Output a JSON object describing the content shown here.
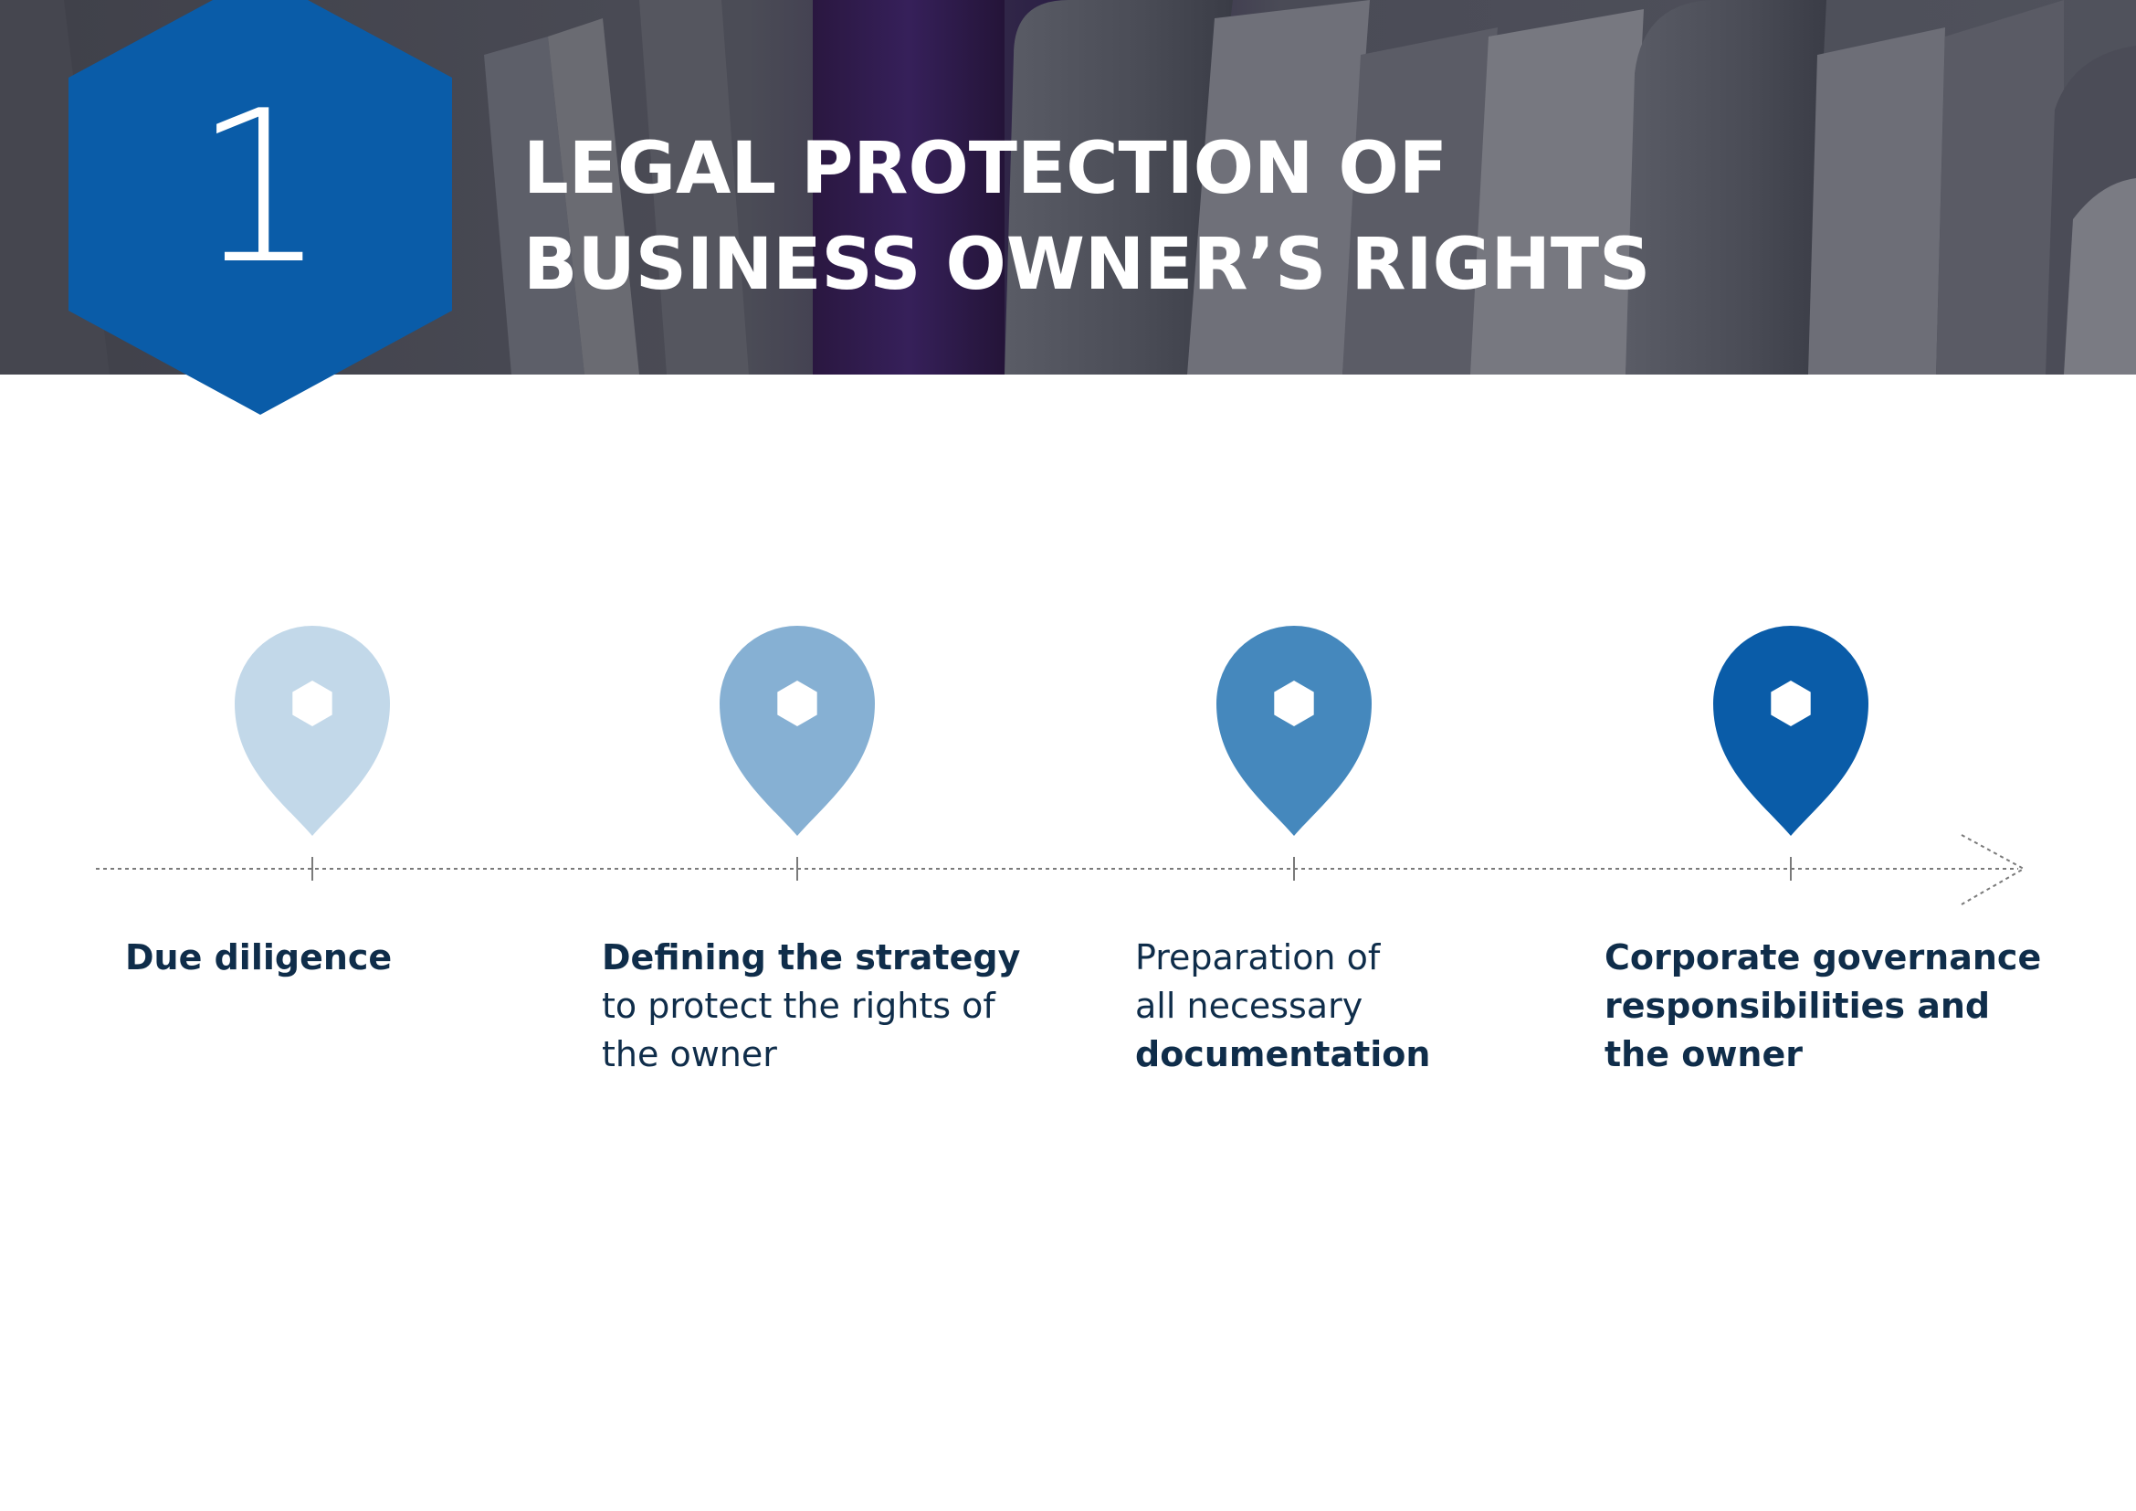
{
  "section": {
    "number": "1",
    "title_line1": "LEGAL PROTECTION OF",
    "title_line2": "BUSINESS OWNER’S RIGHTS"
  },
  "colors": {
    "badge": "#0a5ca8",
    "text_dark": "#0f2d4a",
    "header_bg": "#4a4c57",
    "pins": [
      "#c2d8e9",
      "#86b0d3",
      "#4588bd",
      "#0a5ca8"
    ]
  },
  "steps": [
    {
      "line1_bold": "Due diligence"
    },
    {
      "line1_bold": "Defining the strategy",
      "line2": "to protect the rights of",
      "line3": "the owner"
    },
    {
      "line1": "Preparation of",
      "line2": "all necessary",
      "line3_bold": "documentation"
    },
    {
      "line1_bold": "Corporate governance",
      "line2_bold": "responsibilities and",
      "line3_bold": "the owner"
    }
  ]
}
